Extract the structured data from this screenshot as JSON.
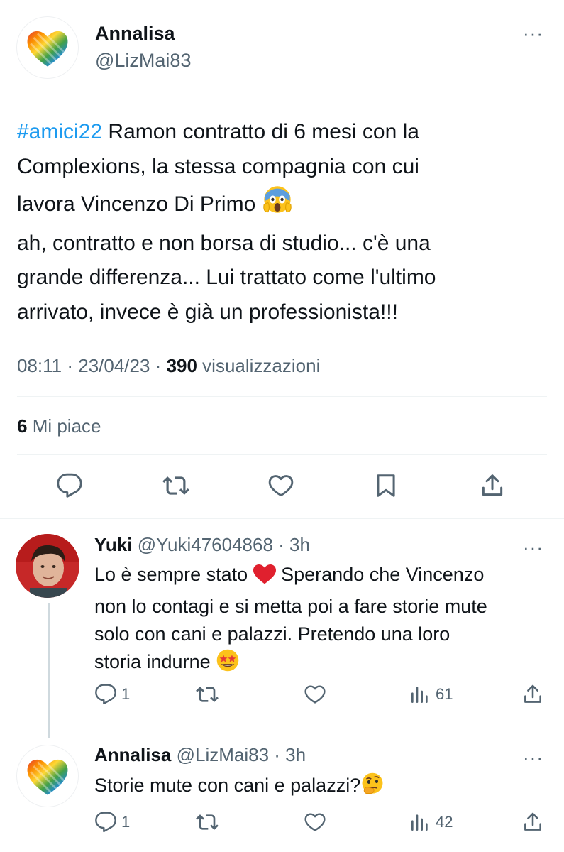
{
  "main_tweet": {
    "author_name": "Annalisa",
    "author_handle": "@LizMai83",
    "more_label": "···",
    "hashtag": "#amici22",
    "text_line1_rest": " Ramon contratto di 6 mesi con la",
    "text_line2": "Complexions, la stessa compagnia con cui",
    "text_line3": "lavora Vincenzo Di Primo ",
    "text_line4": "ah, contratto e non borsa di studio... c'è una",
    "text_line5": "grande differenza... Lui trattato come l'ultimo",
    "text_line6": "arrivato, invece è già un professionista!!!",
    "time": "08:11 · 23/04/23 · ",
    "views_count": "390",
    "views_label": " visualizzazioni",
    "likes_count": "6",
    "likes_label": " Mi piace",
    "accent_color": "#1d9bf0"
  },
  "replies": [
    {
      "author_name": "Yuki",
      "author_handle": "@Yuki47604868 · 3h",
      "more_label": "···",
      "text_line1_a": "Lo è sempre stato ",
      "text_line1_b": " Sperando che Vincenzo",
      "text_line2": "non lo contagi e si metta poi a fare storie mute",
      "text_line3": "solo con cani e palazzi. Pretendo una loro",
      "text_line4": "storia indurne ",
      "reply_count": "1",
      "views_count": "61"
    },
    {
      "author_name": "Annalisa",
      "author_handle": "@LizMai83 · 3h",
      "more_label": "···",
      "text_line1": "Storie mute con cani e palazzi?",
      "reply_count": "1",
      "views_count": "42"
    }
  ],
  "icons": {
    "reply": "speech-bubble-icon",
    "retweet": "retweet-icon",
    "like": "heart-icon",
    "bookmark": "bookmark-icon",
    "share": "share-icon",
    "views": "bar-chart-icon"
  }
}
